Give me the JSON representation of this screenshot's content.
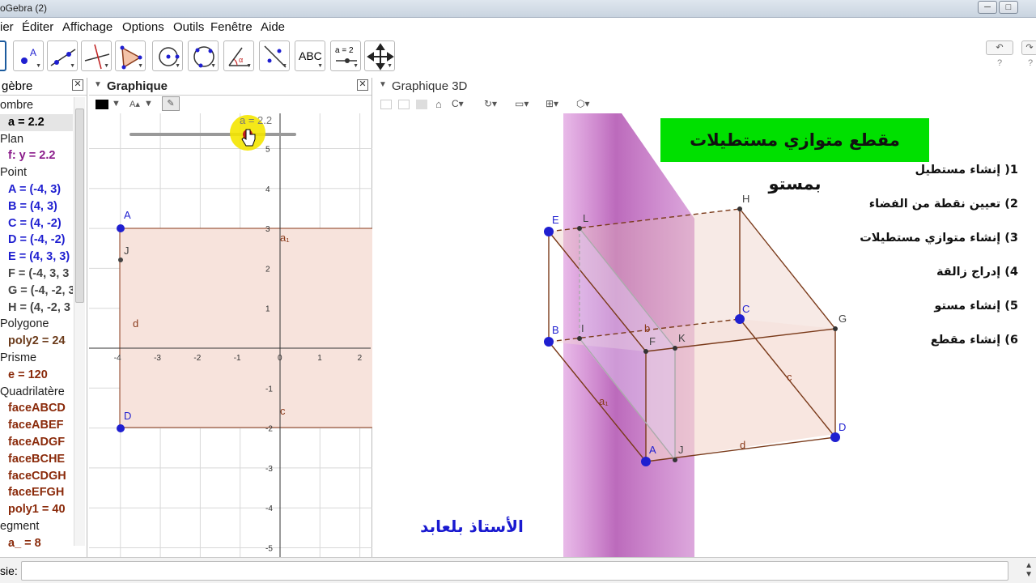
{
  "window": {
    "title": "oGebra (2)",
    "controls": [
      "─",
      "□",
      "✕"
    ]
  },
  "menu": [
    "ier",
    "Éditer",
    "Affichage",
    "Options",
    "Outils",
    "Fenêtre",
    "Aide"
  ],
  "toolbar": {
    "tools": [
      "move-tool",
      "point-tool",
      "line-tool",
      "perpendicular-tool",
      "polygon-tool",
      "circle-tool",
      "conic-tool",
      "angle-tool",
      "reflect-tool",
      "text-tool",
      "slider-tool",
      "move-view-tool"
    ],
    "text_tool_label": "ABC",
    "slider_tool_label": "a = 2",
    "undo": "↶",
    "redo": "↷",
    "help": "?"
  },
  "algebra": {
    "title": "gèbre",
    "items": [
      {
        "kind": "cat",
        "text": "ombre"
      },
      {
        "kind": "obj",
        "text": "a = 2.2",
        "color": "#000000",
        "selected": true
      },
      {
        "kind": "cat",
        "text": "Plan"
      },
      {
        "kind": "obj",
        "text": "f: y = 2.2",
        "color": "#8a1a8a"
      },
      {
        "kind": "cat",
        "text": "Point"
      },
      {
        "kind": "obj",
        "text": "A = (-4, 3)",
        "color": "#1f1fd0"
      },
      {
        "kind": "obj",
        "text": "B = (4, 3)",
        "color": "#1f1fd0"
      },
      {
        "kind": "obj",
        "text": "C = (4, -2)",
        "color": "#1f1fd0"
      },
      {
        "kind": "obj",
        "text": "D = (-4, -2)",
        "color": "#1f1fd0"
      },
      {
        "kind": "obj",
        "text": "E = (4, 3, 3)",
        "color": "#1f1fd0"
      },
      {
        "kind": "obj",
        "text": "F = (-4, 3, 3",
        "color": "#444444"
      },
      {
        "kind": "obj",
        "text": "G = (-4, -2, 3",
        "color": "#444444"
      },
      {
        "kind": "obj",
        "text": "H = (4, -2, 3",
        "color": "#444444"
      },
      {
        "kind": "cat",
        "text": "Polygone"
      },
      {
        "kind": "obj",
        "text": "poly2 = 24",
        "color": "#6a3a1a"
      },
      {
        "kind": "cat",
        "text": "Prisme"
      },
      {
        "kind": "obj",
        "text": "e = 120",
        "color": "#8a2a0a"
      },
      {
        "kind": "cat",
        "text": "Quadrilatère"
      },
      {
        "kind": "obj",
        "text": "faceABCD",
        "color": "#8a2a0a"
      },
      {
        "kind": "obj",
        "text": "faceABEF",
        "color": "#8a2a0a"
      },
      {
        "kind": "obj",
        "text": "faceADGF",
        "color": "#8a2a0a"
      },
      {
        "kind": "obj",
        "text": "faceBCHE",
        "color": "#8a2a0a"
      },
      {
        "kind": "obj",
        "text": "faceCDGH",
        "color": "#8a2a0a"
      },
      {
        "kind": "obj",
        "text": "faceEFGH",
        "color": "#8a2a0a"
      },
      {
        "kind": "obj",
        "text": "poly1 = 40",
        "color": "#8a2a0a"
      },
      {
        "kind": "cat",
        "text": "egment"
      },
      {
        "kind": "obj",
        "text": "a_ = 8",
        "color": "#8a2a0a"
      }
    ]
  },
  "graphique": {
    "title": "Graphique",
    "slider_label": "a = 2.2",
    "x_ticks": [
      "-4",
      "-3",
      "-2",
      "-1",
      "0",
      "1",
      "2"
    ],
    "y_ticks": [
      "5",
      "4",
      "3",
      "2",
      "1",
      "-1",
      "-2",
      "-3",
      "-4",
      "-5"
    ],
    "points": [
      {
        "name": "A",
        "color": "#1f1fd0"
      },
      {
        "name": "D",
        "color": "#1f1fd0"
      },
      {
        "name": "J",
        "color": "#444444"
      }
    ],
    "segment_labels": [
      "a1",
      "d",
      "c"
    ]
  },
  "g3d": {
    "title": "Graphique 3D",
    "heading": "مقطع متوازي مستطيلات بمستو",
    "heading_bg": "#00e000",
    "steps": [
      "1( إنشاء مستطيل",
      "2) تعيين نقطة من الفضاء",
      "3) إنشاء متوازي مستطيلات",
      "4) إدراج زالقة",
      "5) إنشاء مستو",
      "6) إنشاء مقطع"
    ],
    "author": "الأستاذ بلعابد",
    "author_color": "#1a1ad0",
    "points": [
      "E",
      "L",
      "H",
      "B",
      "I",
      "F",
      "K",
      "C",
      "G",
      "A",
      "J",
      "D"
    ],
    "edge_labels": [
      "b",
      "c",
      "a1",
      "d"
    ]
  },
  "inputbar": {
    "label": "sie:",
    "value": ""
  }
}
